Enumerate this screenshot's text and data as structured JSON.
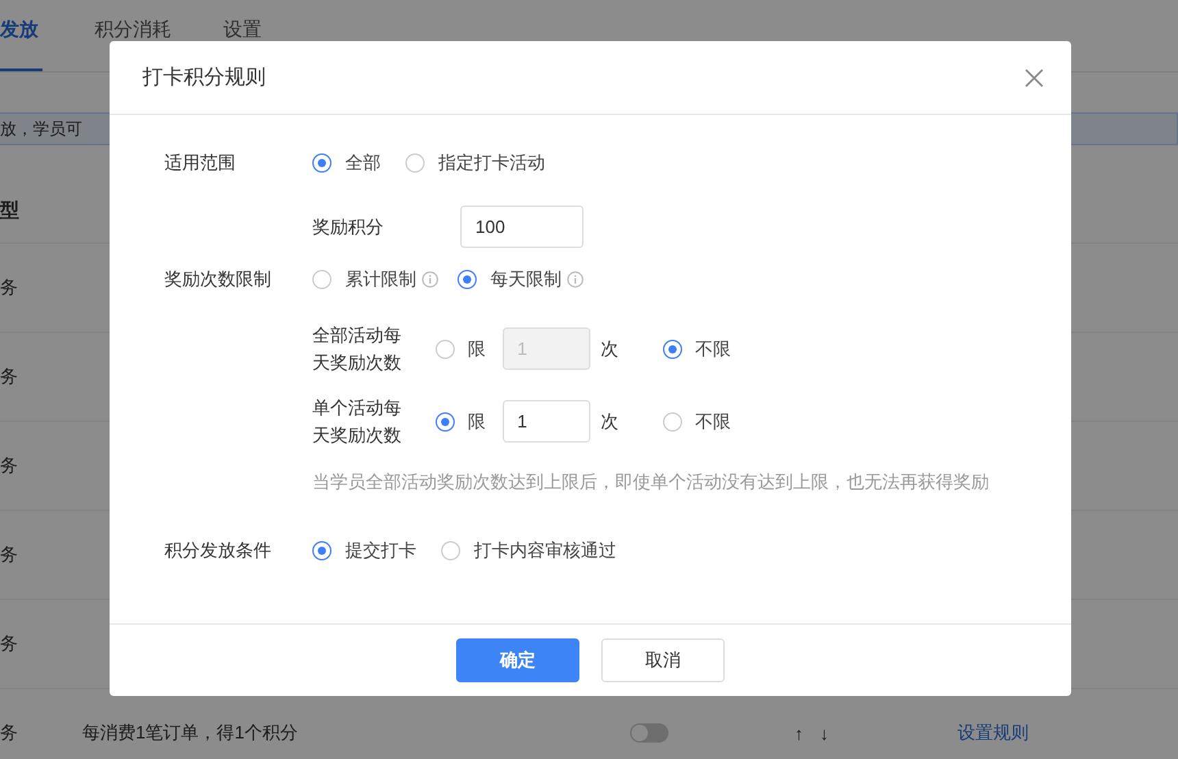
{
  "page": {
    "tabs": [
      {
        "label": "发放",
        "selected": true
      },
      {
        "label": "积分消耗",
        "selected": false
      },
      {
        "label": "设置",
        "selected": false
      }
    ],
    "notice": "放，学员可",
    "table": {
      "columns": [
        "型"
      ],
      "rows": [
        {
          "type": "务"
        },
        {
          "type": "务"
        },
        {
          "type": "务"
        },
        {
          "type": "务"
        },
        {
          "type": "务"
        },
        {
          "type": "务",
          "description": "每消费1笔订单，得1个积分",
          "enabled": false,
          "move_up": "↑",
          "move_down": "↓",
          "action": "设置规则"
        }
      ]
    }
  },
  "dialog": {
    "title": "打卡积分规则",
    "scope": {
      "label": "适用范围",
      "options": [
        {
          "label": "全部",
          "selected": true
        },
        {
          "label": "指定打卡活动",
          "selected": false
        }
      ]
    },
    "points": {
      "label": "奖励积分",
      "value": "100"
    },
    "limit": {
      "label": "奖励次数限制",
      "options": [
        {
          "label": "累计限制",
          "selected": false,
          "info": true
        },
        {
          "label": "每天限制",
          "selected": true,
          "info": true
        }
      ]
    },
    "daily_limits": [
      {
        "label": "全部活动每天奖励次数",
        "limited": {
          "label": "限",
          "selected": false
        },
        "count": {
          "value": "1",
          "disabled": true
        },
        "unit": "次",
        "unlimited": {
          "label": "不限",
          "selected": true
        }
      },
      {
        "label": "单个活动每天奖励次数",
        "limited": {
          "label": "限",
          "selected": true
        },
        "count": {
          "value": "1",
          "disabled": false
        },
        "unit": "次",
        "unlimited": {
          "label": "不限",
          "selected": false
        }
      }
    ],
    "hint": "当学员全部活动奖励次数达到上限后，即使单个活动没有达到上限，也无法再获得奖励",
    "condition": {
      "label": "积分发放条件",
      "options": [
        {
          "label": "提交打卡",
          "selected": true
        },
        {
          "label": "打卡内容审核通过",
          "selected": false
        }
      ]
    },
    "buttons": [
      {
        "label": "确定",
        "kind": "primary"
      },
      {
        "label": "取消",
        "kind": "default"
      }
    ]
  }
}
